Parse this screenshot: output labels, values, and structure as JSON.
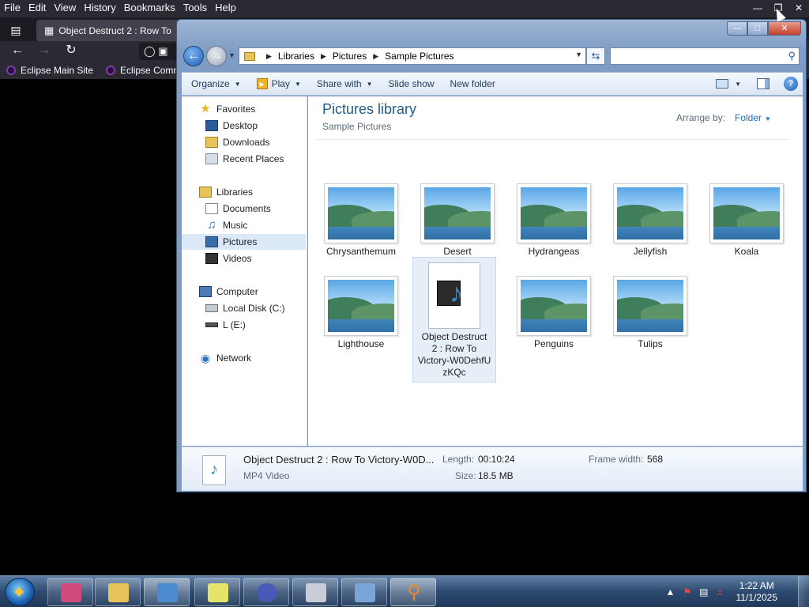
{
  "browser": {
    "menu": [
      "File",
      "Edit",
      "View",
      "History",
      "Bookmarks",
      "Tools",
      "Help"
    ],
    "tab_title": "Object Destruct 2 :  Row To",
    "bookmarks": [
      "Eclipse Main Site",
      "Eclipse Comm"
    ]
  },
  "explorer": {
    "breadcrumb": [
      "Libraries",
      "Pictures",
      "Sample Pictures"
    ],
    "toolbar": {
      "organize": "Organize",
      "play": "Play",
      "share_with": "Share with",
      "slide_show": "Slide show",
      "new_folder": "New folder"
    },
    "nav": {
      "favorites": "Favorites",
      "desktop": "Desktop",
      "downloads": "Downloads",
      "recent_places": "Recent Places",
      "libraries": "Libraries",
      "documents": "Documents",
      "music": "Music",
      "pictures": "Pictures",
      "videos": "Videos",
      "computer": "Computer",
      "local_disk": "Local Disk (C:)",
      "drive_e": "L (E:)",
      "network": "Network"
    },
    "library_title": "Pictures library",
    "library_subtitle": "Sample Pictures",
    "arrange_by_label": "Arrange by:",
    "arrange_by_value": "Folder",
    "items": [
      "Chrysanthemum",
      "Desert",
      "Hydrangeas",
      "Jellyfish",
      "Koala",
      "Lighthouse",
      "Object Destruct 2 :  Row To Victory-W0DehfUzKQc",
      "Penguins",
      "Tulips"
    ],
    "video_label_lines": [
      "Object Destruct",
      "2 :  Row To",
      "Victory-W0DehfU",
      "zKQc"
    ],
    "details": {
      "name": "Object Destruct 2 :  Row To Victory-W0D...",
      "type": "MP4 Video",
      "length_label": "Length:",
      "length_value": "00:10:24",
      "size_label": "Size:",
      "size_value": "18.5 MB",
      "frame_width_label": "Frame width:",
      "frame_width_value": "568"
    }
  },
  "taskbar": {
    "time": "1:22 AM",
    "date": "11/1/2025"
  }
}
